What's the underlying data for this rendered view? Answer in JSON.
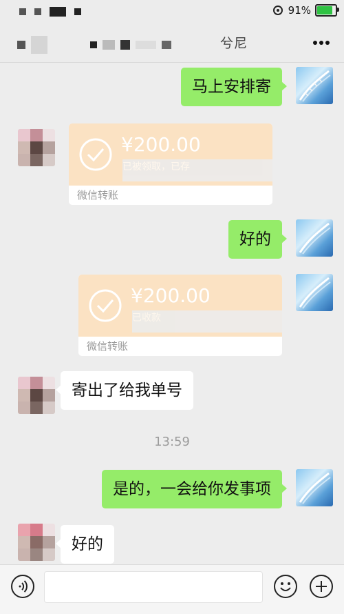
{
  "status_bar": {
    "battery_text": "91%",
    "battery_level": 0.91
  },
  "nav": {
    "title": "兮尼",
    "more_icon": "more-icon"
  },
  "messages": {
    "m1": "马上安排寄",
    "transfer1": {
      "amount": "¥200.00",
      "status": "已被领取，已存",
      "label": "微信转账"
    },
    "m2": "好的",
    "transfer2": {
      "amount": "¥200.00",
      "status": "已收款",
      "label": "微信转账"
    },
    "m3": "寄出了给我单号",
    "time": "13:59",
    "m4": "是的，一会给你发事项",
    "m5": "好的"
  },
  "input_bar": {
    "voice_icon": "voice-icon",
    "emoji_icon": "emoji-icon",
    "plus_icon": "plus-icon"
  },
  "colors": {
    "me_bubble": "#95ec69",
    "other_bubble": "#ffffff",
    "transfer_bg": "#fbe2c3",
    "background": "#ededed"
  }
}
